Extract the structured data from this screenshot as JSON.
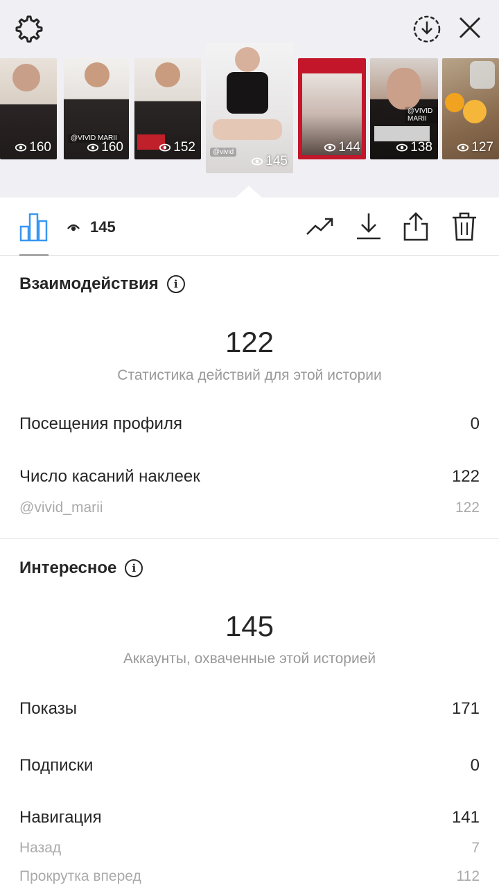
{
  "header": {
    "settings_icon": "gear-icon",
    "download_icon": "download-circle-icon",
    "close_icon": "close-icon"
  },
  "thumbnails": [
    {
      "views": "160"
    },
    {
      "views": "160",
      "tag": "@VIVID MARII"
    },
    {
      "views": "152"
    },
    {
      "views": "145",
      "tag": "@vivid",
      "selected": true
    },
    {
      "views": "144"
    },
    {
      "views": "138",
      "tag": "@VIVID MARII"
    },
    {
      "views": "127"
    }
  ],
  "toolbar": {
    "views": "145",
    "icons": [
      "bar-chart-icon",
      "eye-icon",
      "trend-icon",
      "download-icon",
      "share-icon",
      "trash-icon"
    ]
  },
  "interactions": {
    "title": "Взаимодействия",
    "total": "122",
    "subtitle": "Статистика действий для этой истории",
    "rows": [
      {
        "label": "Посещения профиля",
        "value": "0"
      },
      {
        "label": "Число касаний наклеек",
        "value": "122"
      }
    ],
    "sub_rows": [
      {
        "label": "@vivid_marii",
        "value": "122"
      }
    ]
  },
  "discovery": {
    "title": "Интересное",
    "total": "145",
    "subtitle": "Аккаунты, охваченные этой историей",
    "rows": [
      {
        "label": "Показы",
        "value": "171"
      },
      {
        "label": "Подписки",
        "value": "0"
      },
      {
        "label": "Навигация",
        "value": "141"
      }
    ],
    "sub_rows": [
      {
        "label": "Назад",
        "value": "7"
      },
      {
        "label": "Прокрутка вперед",
        "value": "112"
      }
    ]
  },
  "colors": {
    "accent_blue": "#3897f0",
    "text_primary": "#262626",
    "text_secondary": "#999999",
    "top_band": "#efeff4"
  }
}
